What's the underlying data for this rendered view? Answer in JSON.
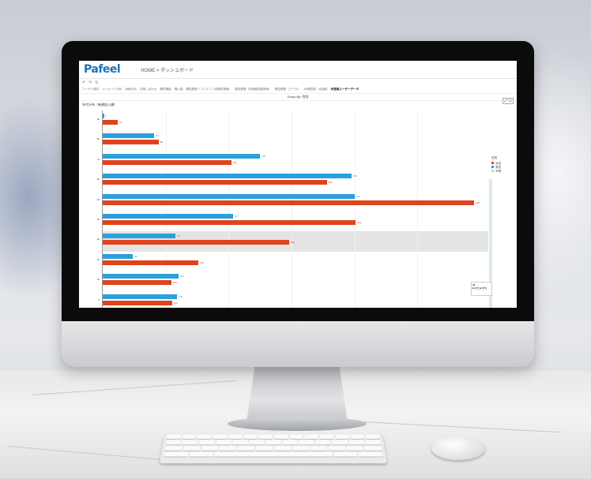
{
  "app": {
    "logo": "Pafeel",
    "breadcrumb": "HOME > ダッシュボード",
    "toolbar": [
      "↶",
      "↷",
      "↻"
    ]
  },
  "tabs": [
    {
      "label": "ユーザー属性"
    },
    {
      "label": "メッセージ分析"
    },
    {
      "label": "休眠分析"
    },
    {
      "label": "お問い合わせ"
    },
    {
      "label": "購買機能"
    },
    {
      "label": "購入数"
    },
    {
      "label": "閲覧履歴（コンテンツ別閲覧情報）"
    },
    {
      "label": "閲覧履歴（詳細閲覧数推移）"
    },
    {
      "label": "閲覧履歴（データ）"
    },
    {
      "label": "AR閲覧数・回遊数"
    },
    {
      "label": "未登録ユーザーデータ",
      "active": true
    }
  ],
  "groupby": "Group By: 性別",
  "chart_title": "年代分布（新規加入順）",
  "corner_button": "⤢ ↻",
  "legend": {
    "title": "性別",
    "items": [
      {
        "label": "女性",
        "color": "#e0431c"
      },
      {
        "label": "男性",
        "color": "#2aa0dc"
      },
      {
        "label": "不明",
        "color": "#cccccc"
      }
    ]
  },
  "tooltip": {
    "title": "30",
    "line1": "■ 女性 ■ 男性"
  },
  "chart_data": {
    "type": "bar",
    "orientation": "horizontal",
    "categories": [
      "90",
      "80",
      "70",
      "60",
      "50",
      "40",
      "30",
      "20",
      "10",
      "0"
    ],
    "series": [
      {
        "name": "男性",
        "color": "#2aa0dc",
        "values": [
          2,
          82,
          250,
          395,
          400,
          207,
          115,
          48,
          120,
          118
        ]
      },
      {
        "name": "女性",
        "color": "#e0431c",
        "values": [
          24,
          89,
          204,
          356,
          590,
          402,
          296,
          152,
          109,
          110
        ]
      }
    ],
    "xlim": [
      0,
      600
    ],
    "grid": true,
    "legend_position": "right",
    "highlight_category": "30"
  }
}
